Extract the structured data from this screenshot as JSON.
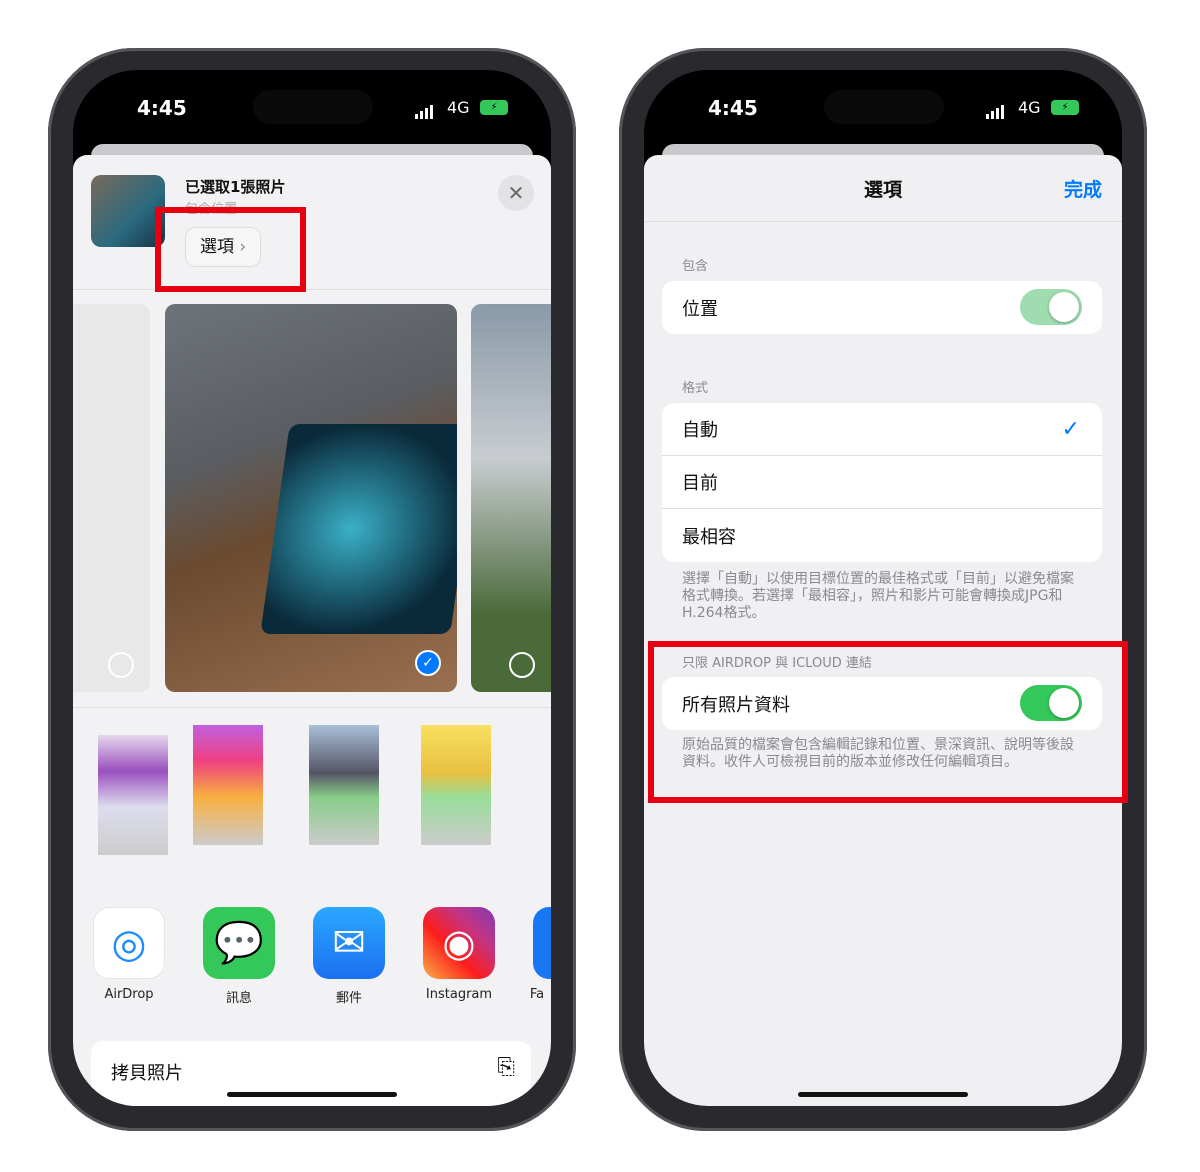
{
  "left": {
    "status": {
      "time": "4:45",
      "network": "4G"
    },
    "header": {
      "title": "已選取1張照片",
      "subtitle": "包含位置",
      "options_button": "選項",
      "close_icon": "close-icon"
    },
    "apps": [
      {
        "label": "AirDrop",
        "color": "#ffffff"
      },
      {
        "label": "訊息",
        "color": "#34c759"
      },
      {
        "label": "郵件",
        "color": "#1a8cff"
      },
      {
        "label": "Instagram",
        "color": "#e1306c"
      },
      {
        "label": "Fa",
        "color": "#1877f2"
      }
    ],
    "action": {
      "label": "拷貝照片",
      "icon": "copy-icon"
    }
  },
  "right": {
    "status": {
      "time": "4:45",
      "network": "4G"
    },
    "nav": {
      "title": "選項",
      "done": "完成"
    },
    "include": {
      "header": "包含",
      "location_label": "位置",
      "location_on": true
    },
    "format": {
      "header": "格式",
      "options": [
        "自動",
        "目前",
        "最相容"
      ],
      "selected": "自動",
      "footer": "選擇「自動」以使用目標位置的最佳格式或「目前」以避免檔案格式轉換。若選擇「最相容」，照片和影片可能會轉換成JPG和H.264格式。"
    },
    "airdrop": {
      "header": "只限 AIRDROP 與 ICLOUD 連結",
      "all_data_label": "所有照片資料",
      "all_data_on": true,
      "footer": "原始品質的檔案會包含編輯記錄和位置、景深資訊、說明等後設資料。收件人可檢視目前的版本並修改任何編輯項目。"
    }
  },
  "colors": {
    "accent": "#007aff",
    "toggle_on": "#34c759",
    "highlight": "#e60012"
  }
}
